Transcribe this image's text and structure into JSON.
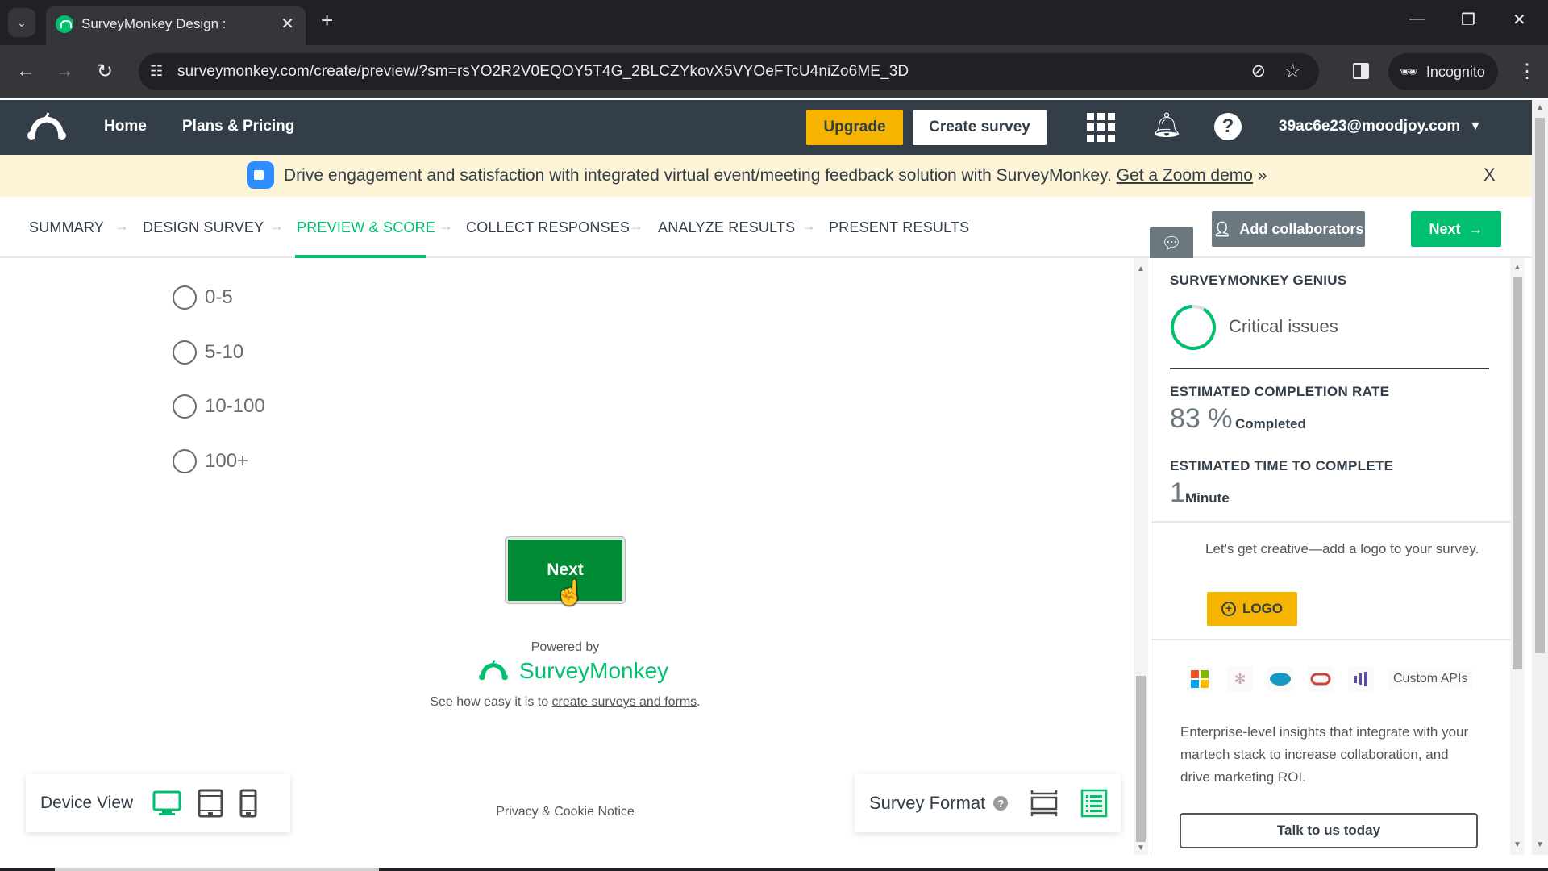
{
  "browser": {
    "tab_title": "SurveyMonkey Design :",
    "url": "surveymonkey.com/create/preview/?sm=rsYO2R2V0EQOY5T4G_2BLCZYkovX5VYOeFTcU4niZo6ME_3D",
    "incognito_label": "Incognito",
    "icons": {
      "tab_list": "chevron-down-icon",
      "close_tab": "close-icon",
      "new_tab": "plus-icon",
      "back": "back-arrow-icon",
      "forward": "forward-arrow-icon",
      "reload": "reload-icon",
      "site_info": "tune-icon",
      "tracking": "eye-off-icon",
      "bookmark": "star-icon",
      "side_panel": "side-panel-icon",
      "menu": "kebab-icon"
    }
  },
  "header": {
    "nav": [
      {
        "label": "Home"
      },
      {
        "label": "Plans & Pricing"
      }
    ],
    "upgrade_label": "Upgrade",
    "create_survey_label": "Create survey",
    "account_email": "39ac6e23@moodjoy.com"
  },
  "banner": {
    "text": "Drive engagement and satisfaction with integrated virtual event/meeting feedback solution with SurveyMonkey.",
    "link_text": "Get a Zoom demo",
    "link_suffix": "»",
    "close": "X"
  },
  "steps": {
    "items": [
      {
        "label": "SUMMARY",
        "active": false
      },
      {
        "label": "DESIGN SURVEY",
        "active": false
      },
      {
        "label": "PREVIEW & SCORE",
        "active": true
      },
      {
        "label": "COLLECT RESPONSES",
        "active": false
      },
      {
        "label": "ANALYZE RESULTS",
        "active": false
      },
      {
        "label": "PRESENT RESULTS",
        "active": false
      }
    ],
    "arrow": "→",
    "add_collaborators_label": "Add collaborators",
    "next_label": "Next",
    "next_arrow": "→"
  },
  "survey": {
    "options": [
      {
        "label": "0-5"
      },
      {
        "label": "5-10"
      },
      {
        "label": "10-100"
      },
      {
        "label": "100+"
      }
    ],
    "next_button": "Next",
    "powered_by": "Powered by",
    "brand": "SurveyMonkey",
    "see_how_prefix": "See how easy it is to ",
    "see_how_link": "create surveys and forms",
    "see_how_suffix": ".",
    "privacy": "Privacy & Cookie Notice"
  },
  "device_view": {
    "label": "Device View",
    "selected": "desktop",
    "options": [
      "desktop",
      "tablet",
      "phone"
    ]
  },
  "survey_format": {
    "label": "Survey Format",
    "help": "?",
    "selected": "classic",
    "options": [
      "one-question-at-a-time",
      "classic"
    ]
  },
  "genius": {
    "title": "SURVEYMONKEY GENIUS",
    "critical_issues": "Critical issues",
    "completion_rate_title": "ESTIMATED COMPLETION RATE",
    "completion_rate_value": "83 %",
    "completion_rate_unit": "Completed",
    "time_title": "ESTIMATED TIME TO COMPLETE",
    "time_value": "1",
    "time_unit": "Minute",
    "logo_text": "Let's get creative—add a logo to your survey.",
    "logo_button": "LOGO",
    "integrations": [
      "microsoft-icon",
      "tableau-icon",
      "salesforce-icon",
      "oracle-icon",
      "marketo-icon"
    ],
    "custom_apis": "Custom APIs",
    "enterprise_text": "Enterprise-level insights that integrate with your martech stack to increase collaboration, and drive marketing ROI.",
    "talk_button": "Talk to us today"
  },
  "colors": {
    "brand_green": "#00bf6f",
    "survey_next_green": "#008a34",
    "header_bg": "#333e48",
    "upgrade_yellow": "#f4b400",
    "banner_bg": "#fdf3d6",
    "collab_gray": "#6b787f"
  }
}
